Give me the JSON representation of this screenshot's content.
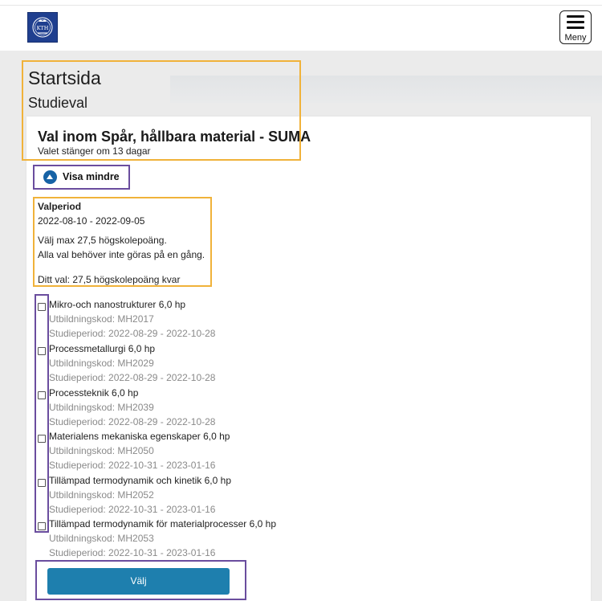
{
  "header": {
    "logo_text": "KTH",
    "menu_label": "Meny"
  },
  "page": {
    "title": "Startsida",
    "subtitle": "Studieval"
  },
  "choice": {
    "title": "Val inom Spår, hållbara material - SUMA",
    "closes": "Valet stänger om 13 dagar",
    "toggle_label": "Visa mindre"
  },
  "info": {
    "period_label": "Valperiod",
    "period": "2022-08-10 - 2022-09-05",
    "max": "Välj max 27,5 högskolepoäng.",
    "note": "Alla val behöver inte göras på en gång.",
    "remaining": "Ditt val: 27,5 högskolepoäng kvar"
  },
  "courses": [
    {
      "name": "Mikro-och nanostrukturer 6,0 hp",
      "code": "Utbildningskod: MH2017",
      "period": "Studieperiod: 2022-08-29 - 2022-10-28"
    },
    {
      "name": "Processmetallurgi 6,0 hp",
      "code": "Utbildningskod: MH2029",
      "period": "Studieperiod: 2022-08-29 - 2022-10-28"
    },
    {
      "name": "Processteknik 6,0 hp",
      "code": "Utbildningskod: MH2039",
      "period": "Studieperiod: 2022-08-29 - 2022-10-28"
    },
    {
      "name": "Materialens mekaniska egenskaper 6,0 hp",
      "code": "Utbildningskod: MH2050",
      "period": "Studieperiod: 2022-10-31 - 2023-01-16"
    },
    {
      "name": "Tillämpad termodynamik och kinetik 6,0 hp",
      "code": "Utbildningskod: MH2052",
      "period": "Studieperiod: 2022-10-31 - 2023-01-16"
    },
    {
      "name": "Tillämpad termodynamik för materialprocesser 6,0 hp",
      "code": "Utbildningskod: MH2053",
      "period": "Studieperiod: 2022-10-31 - 2023-01-16"
    }
  ],
  "submit_label": "Välj",
  "colors": {
    "brand": "#1f3f8f",
    "button": "#1e7fae",
    "toggle_icon": "#1662a5",
    "highlight_orange": "#f0b23a",
    "highlight_purple": "#6a4d9e"
  }
}
